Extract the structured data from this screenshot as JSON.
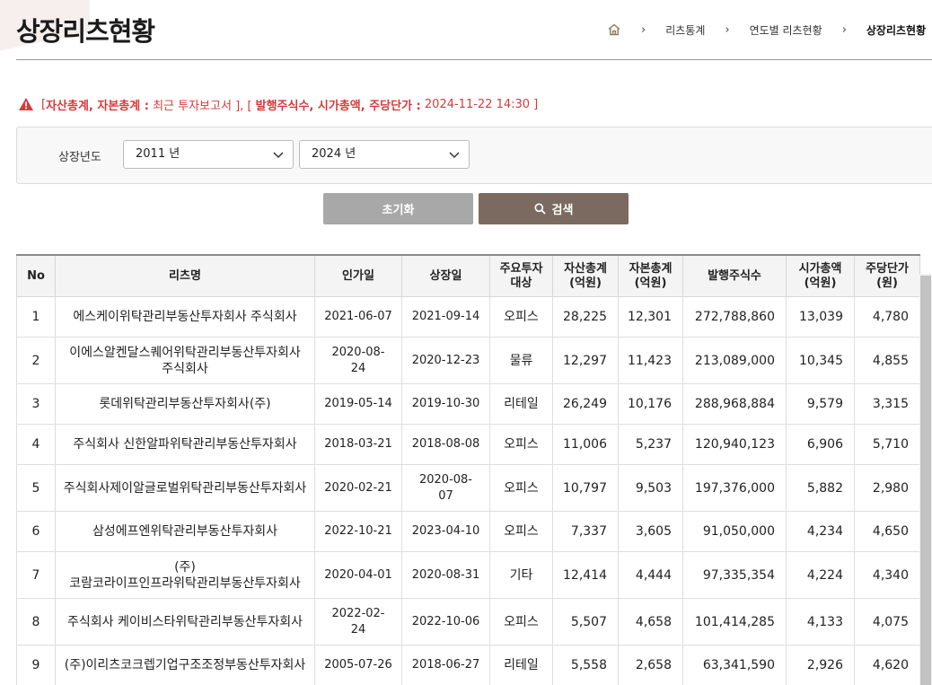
{
  "page": {
    "title": "상장리츠현황"
  },
  "breadcrumb": {
    "items": [
      "리츠통계",
      "연도별 리츠현황",
      "상장리츠현황"
    ]
  },
  "notice": {
    "open": "[ ",
    "part1_bold": "자산총계, 자본총계 :",
    "part1_text": " 최근 투자보고서 ], [ ",
    "part2_bold": "발행주식수, 시가총액, 주당단가 :",
    "part2_text": " 2024-11-22 14:30 ]"
  },
  "filter": {
    "label": "상장년도",
    "from_value": "2011 년",
    "to_value": "2024 년"
  },
  "buttons": {
    "reset": "초기화",
    "search": "검색"
  },
  "table": {
    "headers": {
      "no": "No",
      "name": "리츠명",
      "approval": "인가일",
      "listing": "상장일",
      "sector": [
        "주요투자",
        "대상"
      ],
      "assets": [
        "자산총계",
        "(억원)"
      ],
      "equity": [
        "자본총계",
        "(억원)"
      ],
      "shares": "발행주식수",
      "market_cap": [
        "시가총액",
        "(억원)"
      ],
      "price": [
        "주당단가",
        "(원)"
      ]
    },
    "rows": [
      {
        "no": "1",
        "name": [
          "에스케이위탁관리부동산투자회사 주식회사"
        ],
        "approval": [
          "2021-06-07"
        ],
        "listing": [
          "2021-09-14"
        ],
        "sector": "오피스",
        "assets": "28,225",
        "equity": "12,301",
        "shares": "272,788,860",
        "market_cap": "13,039",
        "price": "4,780"
      },
      {
        "no": "2",
        "name": [
          "이에스알켄달스퀘어위탁관리부동산투자회사",
          "주식회사"
        ],
        "approval": [
          "2020-08-",
          "24"
        ],
        "listing": [
          "2020-12-23"
        ],
        "sector": "물류",
        "assets": "12,297",
        "equity": "11,423",
        "shares": "213,089,000",
        "market_cap": "10,345",
        "price": "4,855"
      },
      {
        "no": "3",
        "name": [
          "롯데위탁관리부동산투자회사(주)"
        ],
        "approval": [
          "2019-05-14"
        ],
        "listing": [
          "2019-10-30"
        ],
        "sector": "리테일",
        "assets": "26,249",
        "equity": "10,176",
        "shares": "288,968,884",
        "market_cap": "9,579",
        "price": "3,315"
      },
      {
        "no": "4",
        "name": [
          "주식회사 신한알파위탁관리부동산투자회사"
        ],
        "approval": [
          "2018-03-21"
        ],
        "listing": [
          "2018-08-08"
        ],
        "sector": "오피스",
        "assets": "11,006",
        "equity": "5,237",
        "shares": "120,940,123",
        "market_cap": "6,906",
        "price": "5,710"
      },
      {
        "no": "5",
        "name": [
          "주식회사제이알글로벌위탁관리부동산투자회사"
        ],
        "approval": [
          "2020-02-21"
        ],
        "listing": [
          "2020-08-",
          "07"
        ],
        "sector": "오피스",
        "assets": "10,797",
        "equity": "9,503",
        "shares": "197,376,000",
        "market_cap": "5,882",
        "price": "2,980"
      },
      {
        "no": "6",
        "name": [
          "삼성에프엔위탁관리부동산투자회사"
        ],
        "approval": [
          "2022-10-21"
        ],
        "listing": [
          "2023-04-10"
        ],
        "sector": "오피스",
        "assets": "7,337",
        "equity": "3,605",
        "shares": "91,050,000",
        "market_cap": "4,234",
        "price": "4,650"
      },
      {
        "no": "7",
        "name": [
          "(주)",
          "코람코라이프인프라위탁관리부동산투자회사"
        ],
        "approval": [
          "2020-04-01"
        ],
        "listing": [
          "2020-08-31"
        ],
        "sector": "기타",
        "assets": "12,414",
        "equity": "4,444",
        "shares": "97,335,354",
        "market_cap": "4,224",
        "price": "4,340"
      },
      {
        "no": "8",
        "name": [
          "주식회사 케이비스타위탁관리부동산투자회사"
        ],
        "approval": [
          "2022-02-",
          "24"
        ],
        "listing": [
          "2022-10-06"
        ],
        "sector": "오피스",
        "assets": "5,507",
        "equity": "4,658",
        "shares": "101,414,285",
        "market_cap": "4,133",
        "price": "4,075"
      },
      {
        "no": "9",
        "name": [
          "(주)이리츠코크렙기업구조조정부동산투자회사"
        ],
        "approval": [
          "2005-07-26"
        ],
        "listing": [
          "2018-06-27"
        ],
        "sector": "리테일",
        "assets": "5,558",
        "equity": "2,658",
        "shares": "63,341,590",
        "market_cap": "2,926",
        "price": "4,620"
      }
    ]
  },
  "colors": {
    "notice_red": "#d9383b",
    "search_brown": "#7a6a5f",
    "reset_gray": "#a8a8a8",
    "home_icon_brown": "#8b7a5c"
  }
}
